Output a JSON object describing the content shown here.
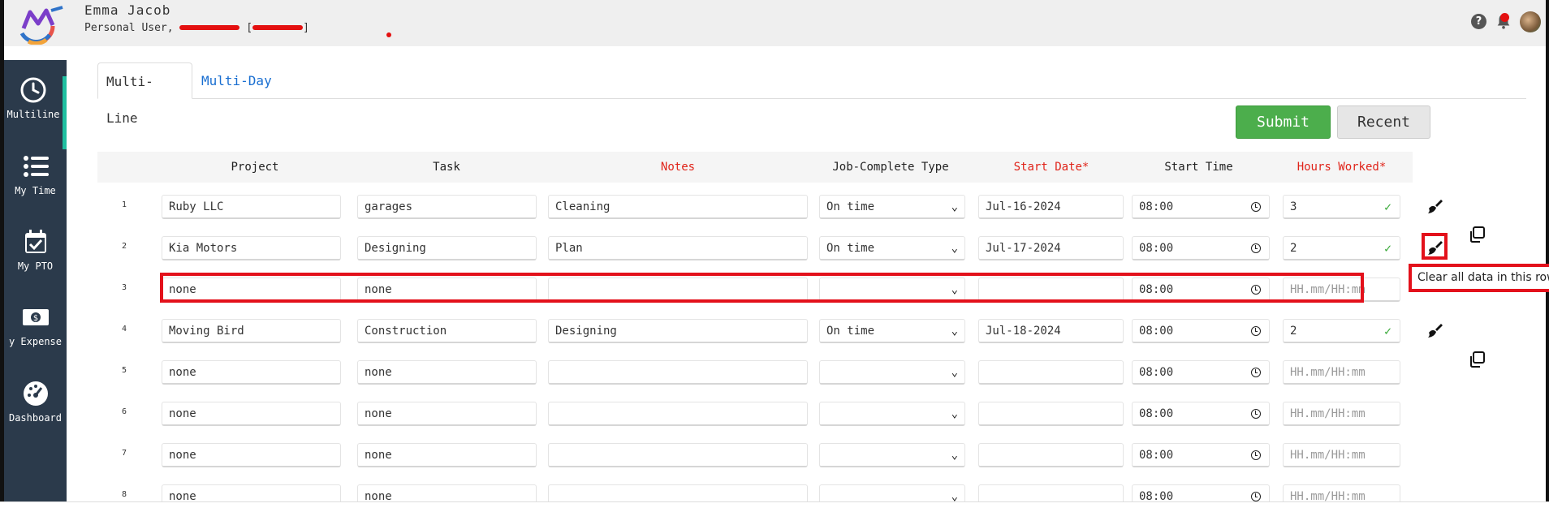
{
  "header": {
    "user_name": "Emma Jacob",
    "user_role_prefix": "Personal User,",
    "bracket_open": "[",
    "bracket_close": "]",
    "help_symbol": "?",
    "icons": [
      "logo-icon",
      "help-icon",
      "bell-icon",
      "avatar"
    ]
  },
  "sidebar": {
    "items": [
      {
        "label": "Multiline",
        "icon": "clock-icon",
        "active": true
      },
      {
        "label": "My Time",
        "icon": "list-icon",
        "active": false
      },
      {
        "label": "My PTO",
        "icon": "calendar-check-icon",
        "active": false
      },
      {
        "label": "y Expense",
        "icon": "money-icon",
        "active": false
      },
      {
        "label": "Dashboard",
        "icon": "dashboard-icon",
        "active": false
      }
    ]
  },
  "tabs": [
    {
      "label": "Multi-Line",
      "active": true
    },
    {
      "label": "Multi-Day",
      "active": false
    }
  ],
  "actions": {
    "submit_label": "Submit",
    "recent_label": "Recent"
  },
  "columns": {
    "project": "Project",
    "task": "Task",
    "notes": "Notes",
    "job_complete": "Job-Complete Type",
    "start_date": "Start Date*",
    "start_time": "Start Time",
    "hours": "Hours Worked*"
  },
  "hours_placeholder": "HH.mm/HH:mm",
  "rows": [
    {
      "num": "1",
      "project": "Ruby LLC",
      "task": "garages",
      "notes": "Cleaning",
      "job_complete": "On time",
      "start_date": "Jul-16-2024",
      "start_time": "08:00",
      "hours": "3"
    },
    {
      "num": "2",
      "project": "Kia Motors",
      "task": "Designing",
      "notes": "Plan",
      "job_complete": "On time",
      "start_date": "Jul-17-2024",
      "start_time": "08:00",
      "hours": "2"
    },
    {
      "num": "3",
      "project": "none",
      "task": "none",
      "notes": "",
      "job_complete": "",
      "start_date": "",
      "start_time": "08:00",
      "hours": ""
    },
    {
      "num": "4",
      "project": "Moving Bird",
      "task": "Construction",
      "notes": "Designing",
      "job_complete": "On time",
      "start_date": "Jul-18-2024",
      "start_time": "08:00",
      "hours": "2"
    },
    {
      "num": "5",
      "project": "none",
      "task": "none",
      "notes": "",
      "job_complete": "",
      "start_date": "",
      "start_time": "08:00",
      "hours": ""
    },
    {
      "num": "6",
      "project": "none",
      "task": "none",
      "notes": "",
      "job_complete": "",
      "start_date": "",
      "start_time": "08:00",
      "hours": ""
    },
    {
      "num": "7",
      "project": "none",
      "task": "none",
      "notes": "",
      "job_complete": "",
      "start_date": "",
      "start_time": "08:00",
      "hours": ""
    },
    {
      "num": "8",
      "project": "none",
      "task": "none",
      "notes": "",
      "job_complete": "",
      "start_date": "",
      "start_time": "08:00",
      "hours": ""
    }
  ],
  "tooltip": {
    "text": "Clear all data in this row"
  },
  "colors": {
    "accent_green": "#4cae4c",
    "sidebar": "#2b3a4b",
    "required_red": "#e0241a",
    "highlight_red": "#e3111b",
    "link_blue": "#1a6fd1"
  }
}
